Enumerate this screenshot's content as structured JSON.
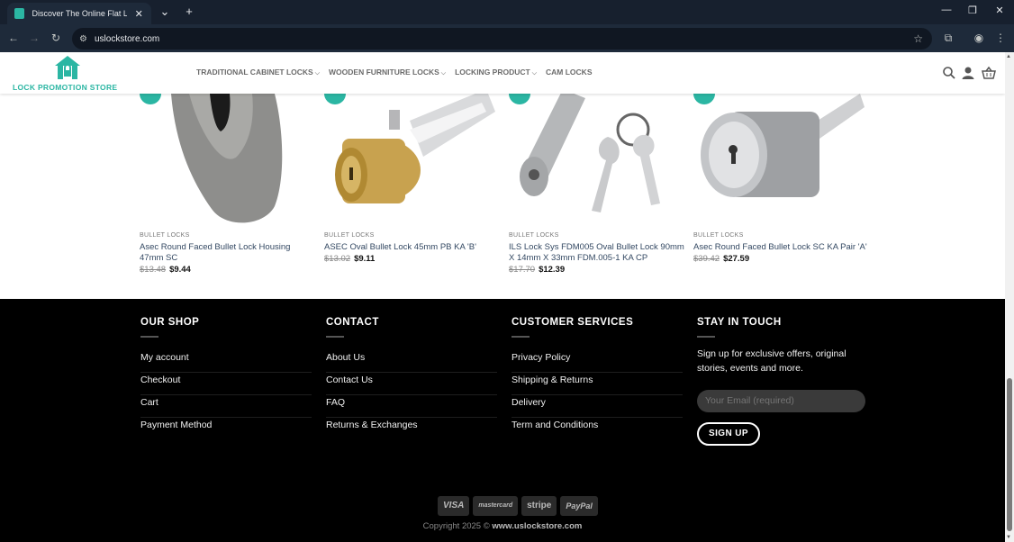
{
  "browser": {
    "tab_title": "Discover The Online Flat Locks /",
    "url": "uslockstore.com"
  },
  "header": {
    "logo_text": "LOCK PROMOTION STORE",
    "nav": [
      {
        "label": "TRADITIONAL CABINET LOCKS",
        "dropdown": true
      },
      {
        "label": "WOODEN FURNITURE LOCKS",
        "dropdown": true
      },
      {
        "label": "LOCKING PRODUCT",
        "dropdown": true
      },
      {
        "label": "CAM LOCKS",
        "dropdown": false
      }
    ]
  },
  "products": [
    {
      "category": "BULLET LOCKS",
      "name": "Asec Round Faced Bullet Lock Housing 47mm SC",
      "old_price": "$13.48",
      "price": "$9.44"
    },
    {
      "category": "BULLET LOCKS",
      "name": "ASEC Oval Bullet Lock 45mm PB KA 'B'",
      "old_price": "$13.02",
      "price": "$9.11"
    },
    {
      "category": "BULLET LOCKS",
      "name": "ILS Lock Sys FDM005 Oval Bullet Lock 90mm X 14mm X 33mm FDM.005-1 KA CP",
      "old_price": "$17.70",
      "price": "$12.39"
    },
    {
      "category": "BULLET LOCKS",
      "name": "Asec Round Faced Bullet Lock SC KA Pair 'A'",
      "old_price": "$39.42",
      "price": "$27.59"
    }
  ],
  "footer": {
    "our_shop": {
      "title": "OUR SHOP",
      "links": [
        "My account",
        "Checkout",
        "Cart",
        "Payment Method"
      ]
    },
    "contact": {
      "title": "CONTACT",
      "links": [
        "About Us",
        "Contact Us",
        "FAQ",
        "Returns & Exchanges"
      ]
    },
    "customer_services": {
      "title": "CUSTOMER SERVICES",
      "links": [
        "Privacy Policy",
        "Shipping & Returns",
        "Delivery",
        "Term and Conditions"
      ]
    },
    "stay_in_touch": {
      "title": "STAY IN TOUCH",
      "text": "Sign up for exclusive offers, original stories, events and more.",
      "email_placeholder": "Your Email (required)",
      "button": "SIGN UP"
    },
    "payments": [
      "VISA",
      "mastercard",
      "stripe",
      "PayPal"
    ],
    "copyright_prefix": "Copyright 2025 © ",
    "copyright_site": "www.uslockstore.com"
  },
  "colors": {
    "brand": "#2bb6a3",
    "link": "#334862"
  }
}
